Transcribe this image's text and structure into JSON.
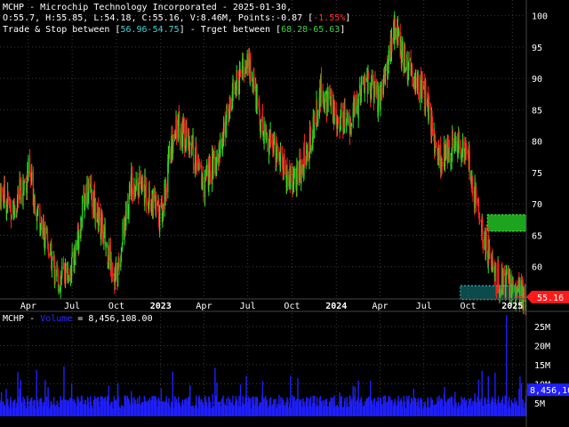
{
  "header": {
    "line1": "MCHP - Microchip Technology Incorporated - 2025-01-30,",
    "line2_pre": "O:55.7, H:55.85, L:54.18, C:55.16, V:8.46M, Points:-0.87 [",
    "line2_pct": "-1.55%",
    "line2_post": "]",
    "line3_pre": "Trade & Stop between [",
    "trade_stop": "56.96-54.75",
    "line3_mid": "] - Trget between [",
    "target": "68.28-65.63",
    "line3_post": "]"
  },
  "volume_panel": {
    "label_pre": "MCHP - ",
    "series_name": "Volume",
    "label_post": " = 8,456,108.00",
    "last_value": "8,456,10"
  },
  "price_panel": {
    "last_price": "55.16"
  },
  "colors": {
    "background": "#000000",
    "up_candle": "#22e622",
    "down_candle": "#ff2020",
    "volume": "#1f1fff",
    "stop_zone": "#1aa6a6",
    "target_zone": "#22c022",
    "price_tag": "#ff1a1a"
  },
  "chart_data": [
    {
      "type": "candlestick",
      "ticker": "MCHP",
      "x_tick_labels": [
        "Apr",
        "Jul",
        "Oct",
        "2023",
        "Apr",
        "Jul",
        "Oct",
        "2024",
        "Apr",
        "Jul",
        "Oct",
        "2025"
      ],
      "x_tick_dates": [
        "2022-04-01",
        "2022-07-01",
        "2022-10-01",
        "2023-01-01",
        "2023-04-01",
        "2023-07-01",
        "2023-10-01",
        "2024-01-01",
        "2024-04-01",
        "2024-07-01",
        "2024-10-01",
        "2025-01-01"
      ],
      "x_range": [
        "2022-02-01",
        "2025-01-30"
      ],
      "y_ticks": [
        60,
        65,
        70,
        75,
        80,
        85,
        90,
        95,
        100
      ],
      "ylim": [
        55.0,
        102.5
      ],
      "grid": true,
      "trend": [
        {
          "date": "2022-02-01",
          "close": 72
        },
        {
          "date": "2022-03-01",
          "close": 69
        },
        {
          "date": "2022-04-01",
          "close": 75
        },
        {
          "date": "2022-05-01",
          "close": 66
        },
        {
          "date": "2022-06-01",
          "close": 58
        },
        {
          "date": "2022-07-01",
          "close": 60
        },
        {
          "date": "2022-08-01",
          "close": 73
        },
        {
          "date": "2022-09-01",
          "close": 66
        },
        {
          "date": "2022-10-01",
          "close": 58
        },
        {
          "date": "2022-11-01",
          "close": 74
        },
        {
          "date": "2022-12-01",
          "close": 72
        },
        {
          "date": "2023-01-01",
          "close": 68
        },
        {
          "date": "2023-02-01",
          "close": 83
        },
        {
          "date": "2023-03-01",
          "close": 80
        },
        {
          "date": "2023-04-01",
          "close": 73
        },
        {
          "date": "2023-05-01",
          "close": 78
        },
        {
          "date": "2023-06-01",
          "close": 88
        },
        {
          "date": "2023-07-01",
          "close": 93
        },
        {
          "date": "2023-08-01",
          "close": 82
        },
        {
          "date": "2023-09-01",
          "close": 78
        },
        {
          "date": "2023-10-01",
          "close": 73
        },
        {
          "date": "2023-11-01",
          "close": 78
        },
        {
          "date": "2023-12-01",
          "close": 88
        },
        {
          "date": "2024-01-01",
          "close": 84
        },
        {
          "date": "2024-02-01",
          "close": 83
        },
        {
          "date": "2024-03-01",
          "close": 90
        },
        {
          "date": "2024-04-01",
          "close": 86
        },
        {
          "date": "2024-05-01",
          "close": 98
        },
        {
          "date": "2024-06-01",
          "close": 91
        },
        {
          "date": "2024-07-01",
          "close": 88
        },
        {
          "date": "2024-08-01",
          "close": 77
        },
        {
          "date": "2024-09-01",
          "close": 80
        },
        {
          "date": "2024-10-01",
          "close": 77
        },
        {
          "date": "2024-11-01",
          "close": 65
        },
        {
          "date": "2024-12-01",
          "close": 58
        },
        {
          "date": "2025-01-30",
          "close": 55.16
        }
      ],
      "last_candle": {
        "date": "2025-01-30",
        "open": 55.7,
        "high": 55.85,
        "low": 54.18,
        "close": 55.16
      },
      "zones": [
        {
          "name": "Trade & Stop",
          "low": 54.75,
          "high": 56.96
        },
        {
          "name": "Target",
          "low": 65.63,
          "high": 68.28
        }
      ]
    },
    {
      "type": "bar",
      "series_name": "Volume",
      "y_tick_labels": [
        "5M",
        "10M",
        "15M",
        "20M",
        "25M"
      ],
      "y_ticks": [
        5000000,
        10000000,
        15000000,
        20000000,
        25000000
      ],
      "ylim": [
        1500000,
        28500000
      ],
      "last_value": 8456108,
      "spike_max": 28000000
    }
  ]
}
